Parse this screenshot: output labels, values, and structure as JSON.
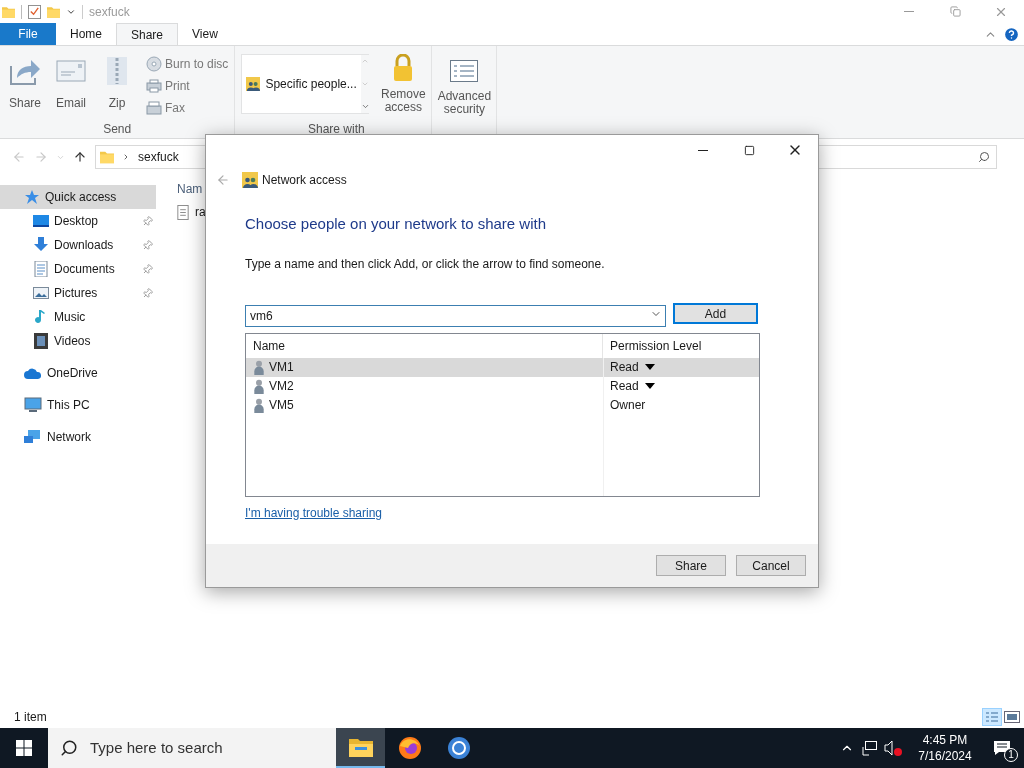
{
  "title_bar": {
    "title": "sexfuck"
  },
  "ribbon_tabs": [
    {
      "label": "File",
      "kind": "file",
      "selected": false
    },
    {
      "label": "Home",
      "kind": "tab",
      "selected": false
    },
    {
      "label": "Share",
      "kind": "tab",
      "selected": true
    },
    {
      "label": "View",
      "kind": "tab",
      "selected": false
    }
  ],
  "ribbon": {
    "send": {
      "label": "Send",
      "large_buttons": [
        {
          "label": "Share",
          "kind": "share"
        },
        {
          "label": "Email",
          "kind": "email"
        },
        {
          "label": "Zip",
          "kind": "zip"
        }
      ],
      "small_buttons": [
        {
          "label": "Burn to disc",
          "kind": "disc"
        },
        {
          "label": "Print",
          "kind": "print"
        },
        {
          "label": "Fax",
          "kind": "fax"
        }
      ]
    },
    "share_with": {
      "label": "Share with",
      "gallery_item": "Specific people...",
      "remove_access": "Remove access"
    },
    "advanced_security": "Advanced security"
  },
  "address_bar": {
    "path": "sexfuck"
  },
  "navigation_pane": [
    {
      "label": "Quick access",
      "kind": "star",
      "selected": true,
      "children": [
        {
          "label": "Desktop",
          "kind": "desktop",
          "pinned": true
        },
        {
          "label": "Downloads",
          "kind": "download",
          "pinned": true
        },
        {
          "label": "Documents",
          "kind": "documents",
          "pinned": true
        },
        {
          "label": "Pictures",
          "kind": "pictures",
          "pinned": true
        },
        {
          "label": "Music",
          "kind": "music",
          "pinned": false
        },
        {
          "label": "Videos",
          "kind": "videos",
          "pinned": false
        }
      ]
    },
    {
      "label": "OneDrive",
      "kind": "cloud",
      "selected": false
    },
    {
      "label": "This PC",
      "kind": "pc",
      "selected": false
    },
    {
      "label": "Network",
      "kind": "network",
      "selected": false
    }
  ],
  "file_list": {
    "column_header": "Nam",
    "rows": [
      "ra"
    ]
  },
  "status_bar": {
    "item_count": "1 item"
  },
  "dialog": {
    "title": "Network access",
    "heading": "Choose people on your network to share with",
    "instruction": "Type a name and then click Add, or click the arrow to find someone.",
    "name_field": {
      "value": "vm6"
    },
    "add_button": "Add",
    "columns": [
      "Name",
      "Permission Level"
    ],
    "rows": [
      {
        "name": "VM1",
        "permission": "Read",
        "dropdown": true,
        "selected": true
      },
      {
        "name": "VM2",
        "permission": "Read",
        "dropdown": true,
        "selected": false
      },
      {
        "name": "VM5",
        "permission": "Owner",
        "dropdown": false,
        "selected": false
      }
    ],
    "help_link": "I'm having trouble sharing",
    "buttons": [
      "Share",
      "Cancel"
    ]
  },
  "taskbar": {
    "search_placeholder": "Type here to search",
    "apps": [
      {
        "kind": "explorer",
        "selected": true
      },
      {
        "kind": "firefox",
        "selected": false
      },
      {
        "kind": "chrome",
        "selected": false
      }
    ],
    "time": "4:45 PM",
    "date": "7/16/2024",
    "notification_count": "1"
  }
}
